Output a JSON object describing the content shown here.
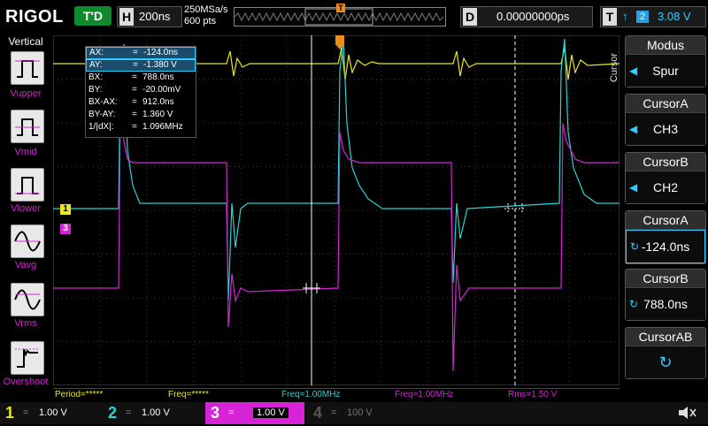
{
  "header": {
    "logo": "RIGOL",
    "run_state": "T'D",
    "timebase_label": "H",
    "timebase_value": "200ns",
    "sample_rate": "250MSa/s",
    "memory_depth": "600 pts",
    "delay_label": "D",
    "delay_value": "0.00000000ps",
    "trigger_label": "T",
    "trigger_edge": "↑",
    "trigger_source": "2",
    "trigger_level": "3.08 V"
  },
  "left_panel": {
    "title": "Vertical",
    "items": [
      {
        "label": "Vupper",
        "icon": "vupper-icon"
      },
      {
        "label": "Vmid",
        "icon": "vmid-icon"
      },
      {
        "label": "Vlower",
        "icon": "vlower-icon"
      },
      {
        "label": "Vavg",
        "icon": "vavg-icon"
      },
      {
        "label": "Vrms",
        "icon": "vrms-icon"
      },
      {
        "label": "Overshoot",
        "icon": "overshoot-icon"
      }
    ]
  },
  "cursor_readout": {
    "rows": [
      {
        "k": "AX:",
        "v": "-124.0ns"
      },
      {
        "k": "AY:",
        "v": "-1.380 V"
      },
      {
        "k": "BX:",
        "v": "788.0ns"
      },
      {
        "k": "BY:",
        "v": "-20.00mV"
      },
      {
        "k": "BX-AX:",
        "v": "912.0ns"
      },
      {
        "k": "BY-AY:",
        "v": "1.360 V"
      },
      {
        "k": "1/|dX|:",
        "v": "1.096MHz"
      }
    ],
    "eq": "="
  },
  "right_panel": {
    "menu_title": "Cursor",
    "items": [
      {
        "head": "Modus",
        "value": "Spur"
      },
      {
        "head": "CursorA",
        "value": "CH3"
      },
      {
        "head": "CursorB",
        "value": "CH2"
      },
      {
        "head": "CursorA",
        "value": "-124.0ns"
      },
      {
        "head": "CursorB",
        "value": "788.0ns"
      },
      {
        "head": "CursorAB",
        "value": "↻"
      }
    ]
  },
  "channel_markers": {
    "ch1": "1",
    "ch3": "3",
    "trigger_pos": "T"
  },
  "measurements": [
    {
      "text": "Period=*****",
      "color": "#e8e81a"
    },
    {
      "text": "Freq=*****",
      "color": "#e8e81a"
    },
    {
      "text": "Freq=1.00MHz",
      "color": "#2ad4d4"
    },
    {
      "text": "Freq=1.00MHz",
      "color": "#d623d6"
    },
    {
      "text": "Rms=1.50 V",
      "color": "#d623d6"
    }
  ],
  "channels": [
    {
      "num": "1",
      "coupling": "=",
      "value": "1.00 V",
      "color": "#e8e81a"
    },
    {
      "num": "2",
      "coupling": "=",
      "value": "1.00 V",
      "color": "#2ad4d4"
    },
    {
      "num": "3",
      "coupling": "=",
      "value": "1.00 V",
      "color": "#d623d6"
    },
    {
      "num": "4",
      "coupling": "=",
      "value": "100 V",
      "color": "#555555"
    }
  ],
  "colors": {
    "ch1": "#e8e81a",
    "ch2": "#2ad4d4",
    "ch3": "#d623d6",
    "accent": "#2a9fe0",
    "trigger": "#f08a1a"
  }
}
